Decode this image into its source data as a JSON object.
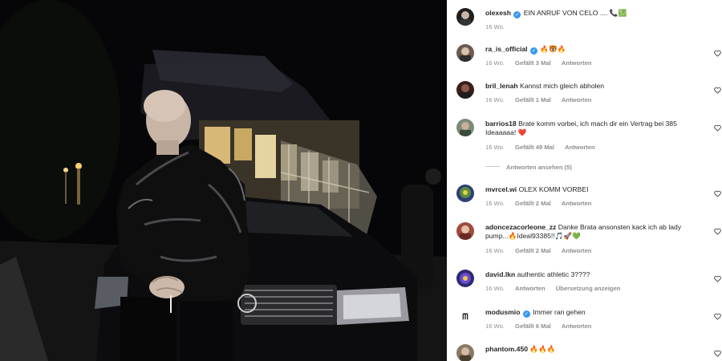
{
  "post": {
    "author": "olexesh",
    "caption": "EIN ANRUF VON CELO ....",
    "caption_emojis": "📞💹",
    "time": "16 Wo."
  },
  "labels": {
    "reply": "Antworten",
    "view_replies": "Antworten ansehen (5)",
    "translate": "Übersetzung anzeigen"
  },
  "comments": [
    {
      "user": "ra_is_official",
      "verified": true,
      "text": "🔥🐯🔥",
      "time": "16 Wo.",
      "likes": "Gefällt 3 Mal"
    },
    {
      "user": "bril_lenah",
      "verified": false,
      "text": "Kannst mich gleich abholen",
      "time": "16 Wo.",
      "likes": "Gefällt 1 Mal"
    },
    {
      "user": "barrios18",
      "verified": false,
      "text": "Brate komm vorbei, ich mach dir ein Vertrag bei 385 Ideaaaaa! ❤️",
      "time": "16 Wo.",
      "likes": "Gefällt 49 Mal"
    },
    {
      "user": "mvrcel.wi",
      "verified": false,
      "text": "OLEX KOMM VORBEI",
      "time": "16 Wo.",
      "likes": "Gefällt 2 Mal"
    },
    {
      "user": "adoncezacorleone_zz",
      "verified": false,
      "text": "Danke Brata ansonsten kack ich ab lady pump...🔥Ideal93385!!🎵🚀💚",
      "time": "16 Wo.",
      "likes": "Gefällt 2 Mal"
    },
    {
      "user": "david.lkn",
      "verified": false,
      "text": "authentic athletic 3????",
      "time": "16 Wo."
    },
    {
      "user": "modusmio",
      "verified": true,
      "text": "Immer ran gehen",
      "time": "16 Wo.",
      "likes": "Gefällt 6 Mal"
    },
    {
      "user": "phantom.450",
      "verified": false,
      "text": "🔥🔥🔥"
    }
  ]
}
